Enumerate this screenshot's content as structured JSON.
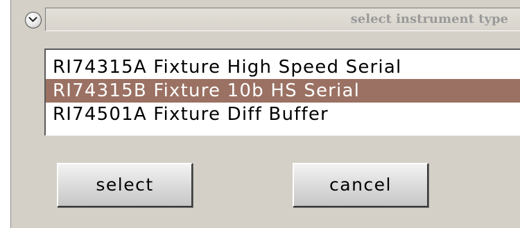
{
  "dialog": {
    "title": "select instrument type",
    "collapse_icon": "chevron-down-icon"
  },
  "instrument_list": {
    "items": [
      {
        "label": "RI74315A Fixture High Speed Serial",
        "selected": false
      },
      {
        "label": "RI74315B Fixture 10b HS Serial",
        "selected": true
      },
      {
        "label": "RI74501A Fixture Diff Buffer",
        "selected": false
      }
    ]
  },
  "buttons": {
    "select_label": "select",
    "cancel_label": "cancel"
  },
  "colors": {
    "selection_background": "#9b7163",
    "dialog_background": "#d4d0c8"
  }
}
